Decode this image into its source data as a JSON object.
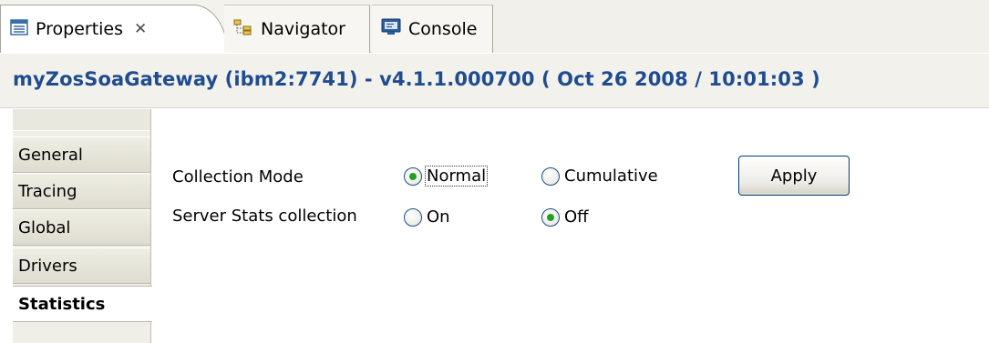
{
  "tabs": [
    {
      "label": "Properties",
      "icon": "properties-icon",
      "active": true,
      "close": "✕"
    },
    {
      "label": "Navigator",
      "icon": "navigator-icon",
      "active": false
    },
    {
      "label": "Console",
      "icon": "console-icon",
      "active": false
    }
  ],
  "header": {
    "title": "myZosSoaGateway (ibm2:7741) - v4.1.1.000700 ( Oct 26 2008 / 10:01:03 )",
    "title_color": "#1f4c8f"
  },
  "sidenav": {
    "items": [
      "General",
      "Tracing",
      "Global",
      "Drivers",
      "Statistics"
    ],
    "active": "Statistics"
  },
  "form": {
    "collection_mode_label": "Collection Mode",
    "collection_mode_options": [
      "Normal",
      "Cumulative"
    ],
    "collection_mode_selected": "Normal",
    "server_stats_label": "Server Stats collection",
    "server_stats_options": [
      "On",
      "Off"
    ],
    "server_stats_selected": "Off",
    "apply_label": "Apply"
  },
  "colors": {
    "accent_radio": "#21a121",
    "button_border": "#003c74"
  }
}
